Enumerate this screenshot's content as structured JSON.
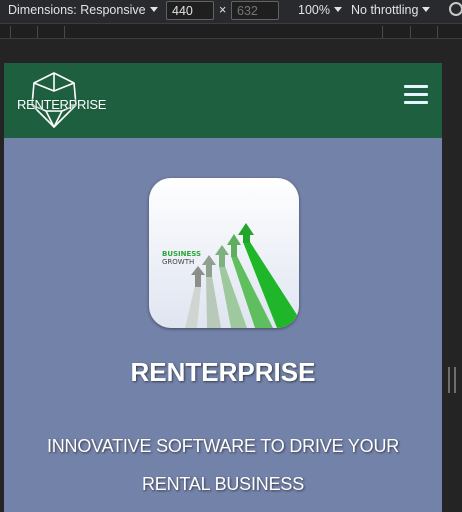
{
  "devtools": {
    "dimensions_label": "Dimensions: Responsive",
    "width_value": "440",
    "height_placeholder": "632",
    "times_symbol": "×",
    "zoom_label": "100%",
    "throttling_label": "No throttling"
  },
  "site": {
    "logo_text": "RENTERPRISE",
    "menu_icon": "hamburger-icon",
    "app_icon": {
      "label_line1": "BUSINESS",
      "label_line2": "GROWTH"
    },
    "brand_title": "RENTERPRISE",
    "tagline": "INNOVATIVE SOFTWARE TO DRIVE YOUR RENTAL BUSINESS"
  },
  "colors": {
    "header_bg": "#1e5f3f",
    "page_bg": "#7382a8",
    "devtools_bg": "#292a2d",
    "arrow_green": "#2aa63a"
  }
}
